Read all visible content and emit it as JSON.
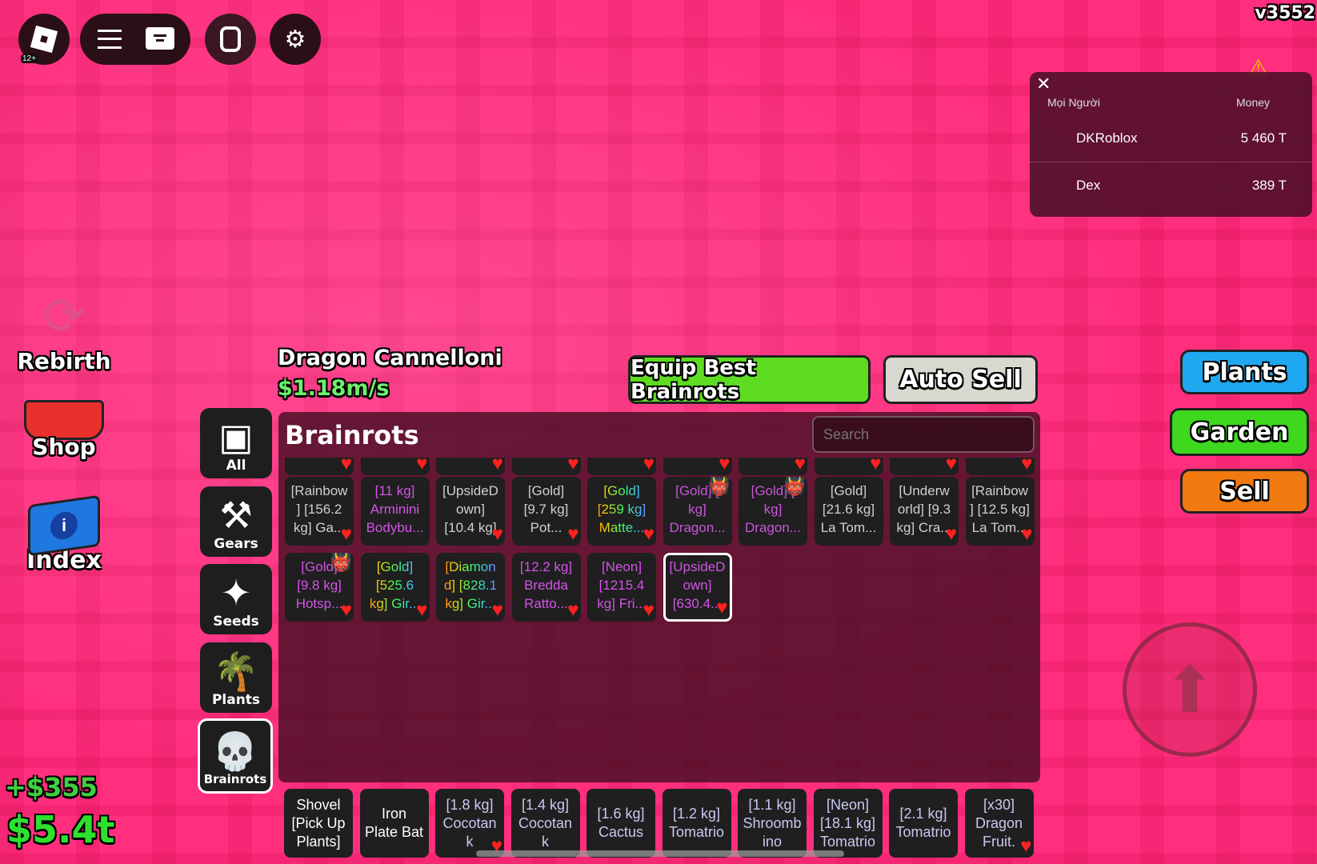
{
  "topbar": {
    "age_badge": "12+",
    "version": "v3552"
  },
  "leaderboard": {
    "col_people": "Mọi Người",
    "col_money": "Money",
    "rows": [
      {
        "name": "DKRoblox",
        "money": "5 460 T"
      },
      {
        "name": "Dex",
        "money": "389 T"
      }
    ]
  },
  "left_menu": {
    "rebirth": "Rebirth",
    "shop": "Shop",
    "index": "Index"
  },
  "currency": {
    "gain": "+$355",
    "total": "$5.4t"
  },
  "selected": {
    "name": "Dragon Cannelloni",
    "rate": "$1.18m/s"
  },
  "actions": {
    "equip_best": "Equip Best Brainrots",
    "auto_sell": "Auto Sell"
  },
  "categories": [
    {
      "label": "All"
    },
    {
      "label": "Gears"
    },
    {
      "label": "Seeds"
    },
    {
      "label": "Plants"
    },
    {
      "label": "Brainrots"
    }
  ],
  "panel": {
    "title": "Brainrots",
    "search_placeholder": "Search"
  },
  "grid": [
    [
      {
        "lines": [
          "[Rainbow",
          "] [156.2",
          "kg] Ga..."
        ],
        "color": "#d0d0d0",
        "heart": true
      },
      {
        "lines": [
          "[11 kg]",
          "Arminini",
          "Bodybu..."
        ],
        "color": "#d254e6",
        "heart": false
      },
      {
        "lines": [
          "[UpsideD",
          "own]",
          "[10.4 kg]"
        ],
        "color": "#d0d0d0",
        "heart": true
      },
      {
        "lines": [
          "[Gold]",
          "[9.7 kg]",
          "Pot..."
        ],
        "color": "#d0d0d0",
        "heart": true
      },
      {
        "lines": [
          "[Gold]",
          "[259 kg]",
          "Matte..."
        ],
        "color": "rainbow",
        "heart": true
      },
      {
        "lines": [
          "[Gold] [",
          "kg]",
          "Dragon..."
        ],
        "color": "#c856d8",
        "heart": false,
        "devil": true
      },
      {
        "lines": [
          "[Gold] [",
          "kg]",
          "Dragon..."
        ],
        "color": "#c856d8",
        "heart": false,
        "devil": true
      },
      {
        "lines": [
          "[Gold]",
          "[21.6 kg]",
          "La Tom..."
        ],
        "color": "#d0d0d0",
        "heart": false
      },
      {
        "lines": [
          "[Underw",
          "orld] [9.3",
          "kg] Cra..."
        ],
        "color": "#d0d0d0",
        "heart": true
      },
      {
        "lines": [
          "[Rainbow",
          "] [12.5 kg]",
          "La Tom..."
        ],
        "color": "#d0d0d0",
        "heart": true
      }
    ],
    [
      {
        "lines": [
          "[Gold]",
          "[9.8 kg]",
          "Hotsp..."
        ],
        "color": "#d254e6",
        "heart": true,
        "devil": true
      },
      {
        "lines": [
          "[Gold]",
          "[525.6",
          "kg] Gir..."
        ],
        "color": "rainbow",
        "heart": true
      },
      {
        "lines": [
          "[Diamon",
          "d] [828.1",
          "kg] Gir..."
        ],
        "color": "rainbow",
        "heart": true
      },
      {
        "lines": [
          "[12.2 kg]",
          "Bredda",
          "Ratto..."
        ],
        "color": "#d254e6",
        "heart": true
      },
      {
        "lines": [
          "[Neon]",
          "[1215.4",
          "kg] Fri..."
        ],
        "color": "#d254e6",
        "heart": true
      },
      {
        "lines": [
          "[UpsideD",
          "own]",
          "[630.4..."
        ],
        "color": "#d254e6",
        "heart": true,
        "selected": true
      }
    ]
  ],
  "hotbar": [
    {
      "lines": [
        "Shovel",
        "[Pick Up",
        "Plants]"
      ],
      "color": "#ffffff"
    },
    {
      "lines": [
        "Iron",
        "Plate Bat"
      ],
      "color": "#ffffff"
    },
    {
      "lines": [
        "[1.8 kg]",
        "Cocotan",
        "k"
      ],
      "color": "#c8c8f2",
      "heart": true
    },
    {
      "lines": [
        "[1.4 kg]",
        "Cocotan",
        "k"
      ],
      "color": "#c8c8f2"
    },
    {
      "lines": [
        "[1.6 kg]",
        "Cactus"
      ],
      "color": "#c8c8f2"
    },
    {
      "lines": [
        "[1.2 kg]",
        "Tomatrio"
      ],
      "color": "#c8c8f2"
    },
    {
      "lines": [
        "[1.1 kg]",
        "Shroomb",
        "ino"
      ],
      "color": "#c8c8f2"
    },
    {
      "lines": [
        "[Neon]",
        "[18.1 kg]",
        "Tomatrio"
      ],
      "color": "#c8c8f2"
    },
    {
      "lines": [
        "[2.1 kg]",
        "Tomatrio"
      ],
      "color": "#c8c8f2"
    },
    {
      "lines": [
        "[x30]",
        "Dragon",
        "Fruit."
      ],
      "color": "#c8c8f2",
      "heart": true
    }
  ],
  "right_menu": {
    "plants": "Plants",
    "garden": "Garden",
    "sell": "Sell"
  }
}
